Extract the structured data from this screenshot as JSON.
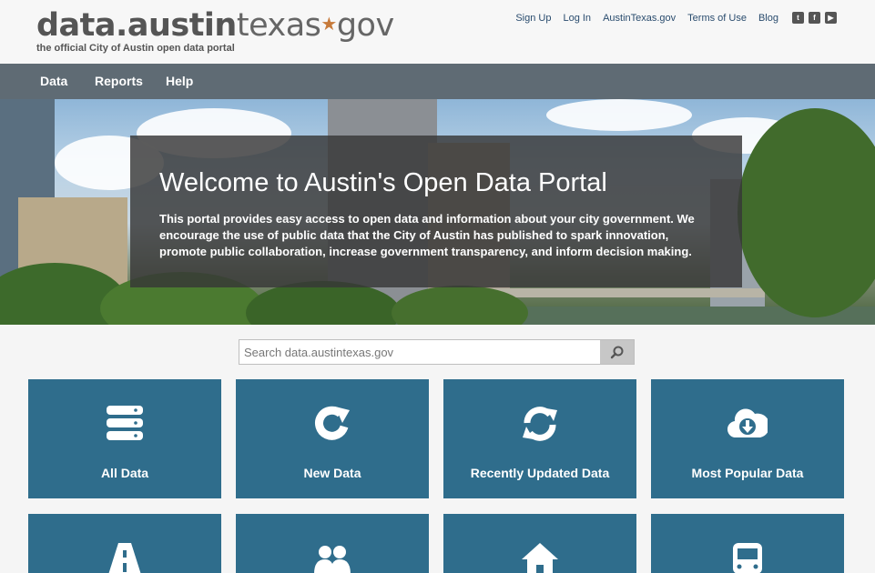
{
  "header": {
    "logo_data": "data.",
    "logo_austin": "austin",
    "logo_texas": "texas",
    "logo_gov": "gov",
    "logo_star": "★",
    "tagline": "the official City of Austin open data portal"
  },
  "toplinks": {
    "signup": "Sign Up",
    "login": "Log In",
    "austintexas": "AustinTexas.gov",
    "terms": "Terms of Use",
    "blog": "Blog"
  },
  "social": {
    "twitter": "t",
    "facebook": "f",
    "youtube": "▶"
  },
  "nav": {
    "data": "Data",
    "reports": "Reports",
    "help": "Help"
  },
  "hero": {
    "title": "Welcome to Austin's Open Data Portal",
    "text": "This portal provides easy access to open data and information about your city government. We encourage the use of public data that the City of Austin has published to spark innovation, promote public collaboration, increase government transparency, and inform decision making."
  },
  "search": {
    "placeholder": "Search data.austintexas.gov"
  },
  "tiles": [
    {
      "label": "All Data",
      "icon": "database-icon"
    },
    {
      "label": "New Data",
      "icon": "refresh-arrow-icon"
    },
    {
      "label": "Recently Updated Data",
      "icon": "sync-icon"
    },
    {
      "label": "Most Popular Data",
      "icon": "cloud-download-icon"
    }
  ],
  "tiles_row2": [
    {
      "icon": "road-icon"
    },
    {
      "icon": "people-icon"
    },
    {
      "icon": "home-icon"
    },
    {
      "icon": "bus-icon"
    }
  ],
  "colors": {
    "nav_bg": "#5f6b74",
    "tile_bg": "#2f6d8c",
    "link": "#2a4c6e",
    "star": "#c77a3a"
  }
}
